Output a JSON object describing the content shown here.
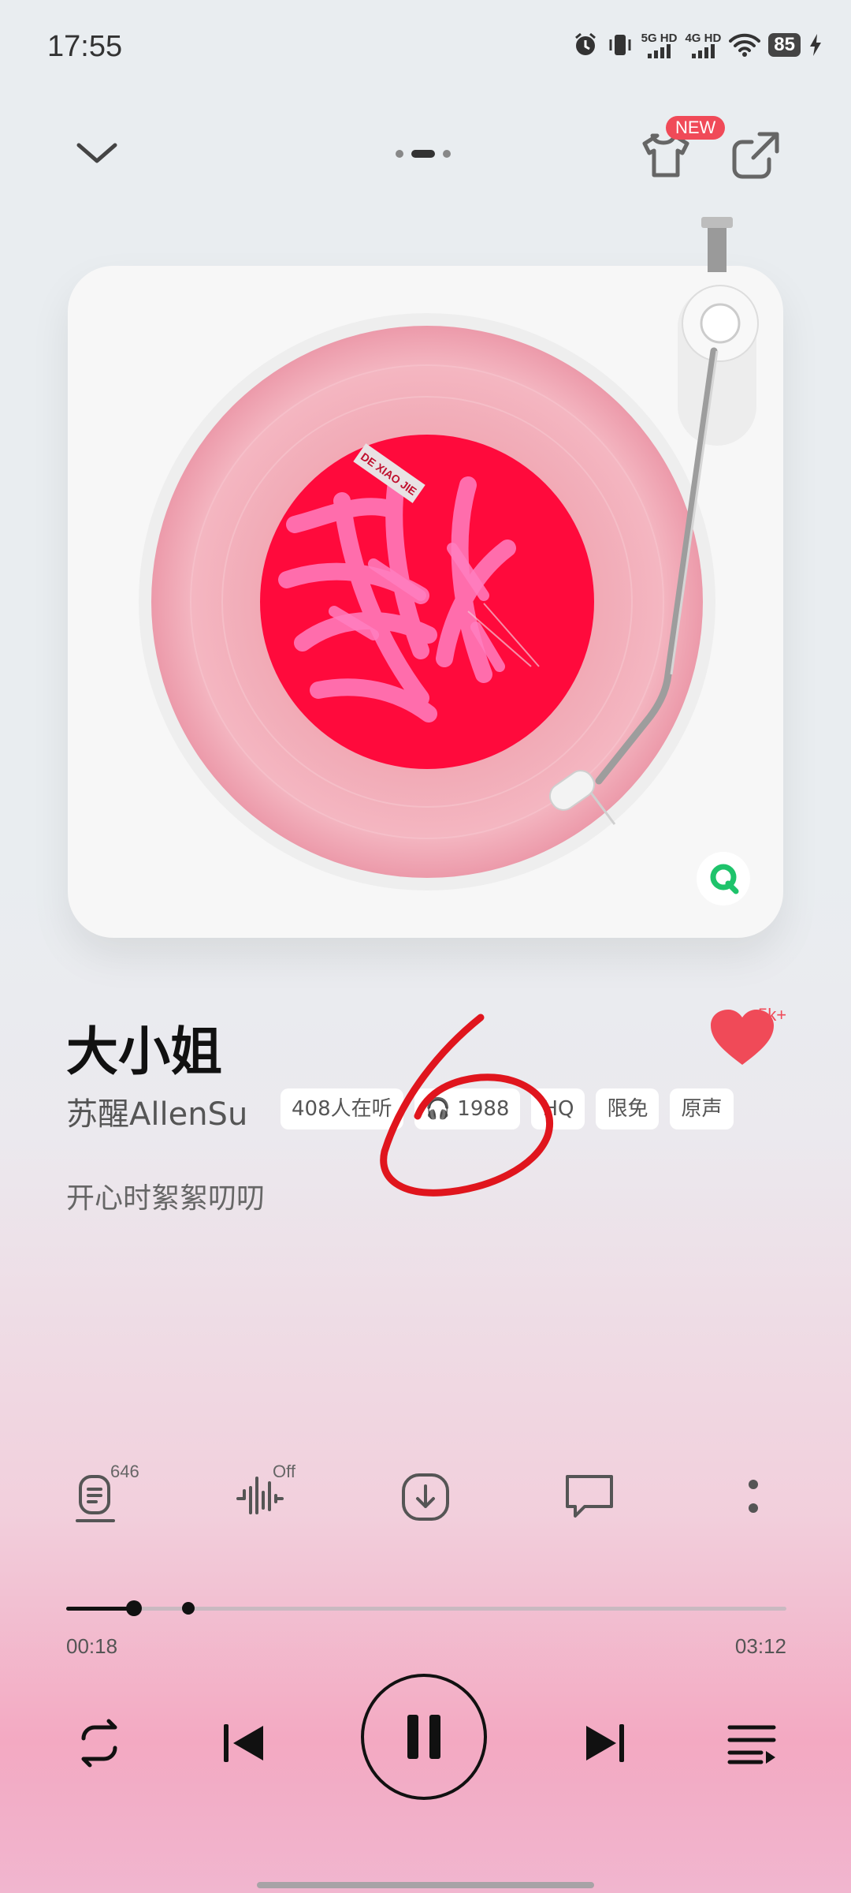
{
  "status_bar": {
    "time": "17:55",
    "net1": "5G HD",
    "net2": "4G HD",
    "battery": "85"
  },
  "header": {
    "badge": "NEW"
  },
  "song": {
    "title": "大小姐",
    "artist": "苏醒AllenSu",
    "tags": [
      "408人在听",
      "1988",
      "HQ",
      "限免",
      "原声"
    ],
    "subtitle": "开心时絮絮叨叨"
  },
  "like": {
    "count": "5k+",
    "color": "#f04a58"
  },
  "album_label": "DE XIAO JIE",
  "actions": {
    "lyrics_count": "646",
    "effect_state": "Off"
  },
  "progress": {
    "elapsed": "00:18",
    "total": "03:12",
    "played_fraction": 0.094,
    "buffered_fraction": 0.17
  },
  "icons": [
    "chevron-down-icon",
    "tshirt-icon",
    "share-icon",
    "lyrics-icon",
    "sound-effect-icon",
    "download-icon",
    "comment-icon",
    "more-icon",
    "repeat-icon",
    "previous-icon",
    "pause-icon",
    "next-icon",
    "playlist-icon"
  ]
}
